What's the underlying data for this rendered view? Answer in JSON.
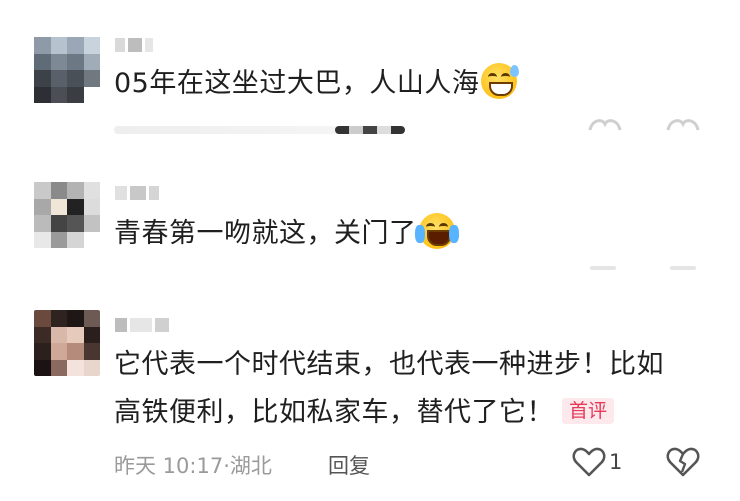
{
  "comments": [
    {
      "text": "05年在这坐过大巴，人山人海",
      "emoji": "grinning-sweat-emoji"
    },
    {
      "text": "青春第一吻就这，关门了",
      "emoji": "crying-laughing-emoji"
    },
    {
      "text_line1": "它代表一个时代结束，也代表一种进步！比如",
      "text_line2": "高铁便利，比如私家车，替代了它！",
      "badge": "首评",
      "time": "昨天 10:17",
      "separator": "·",
      "location": "湖北",
      "reply_label": "回复",
      "like_count": "1"
    }
  ],
  "colors": {
    "badge_bg": "#fde8ec",
    "badge_text": "#e63a5a",
    "meta_text": "#9a9a9a"
  },
  "icons": [
    "heart-outline-icon",
    "broken-heart-icon"
  ]
}
